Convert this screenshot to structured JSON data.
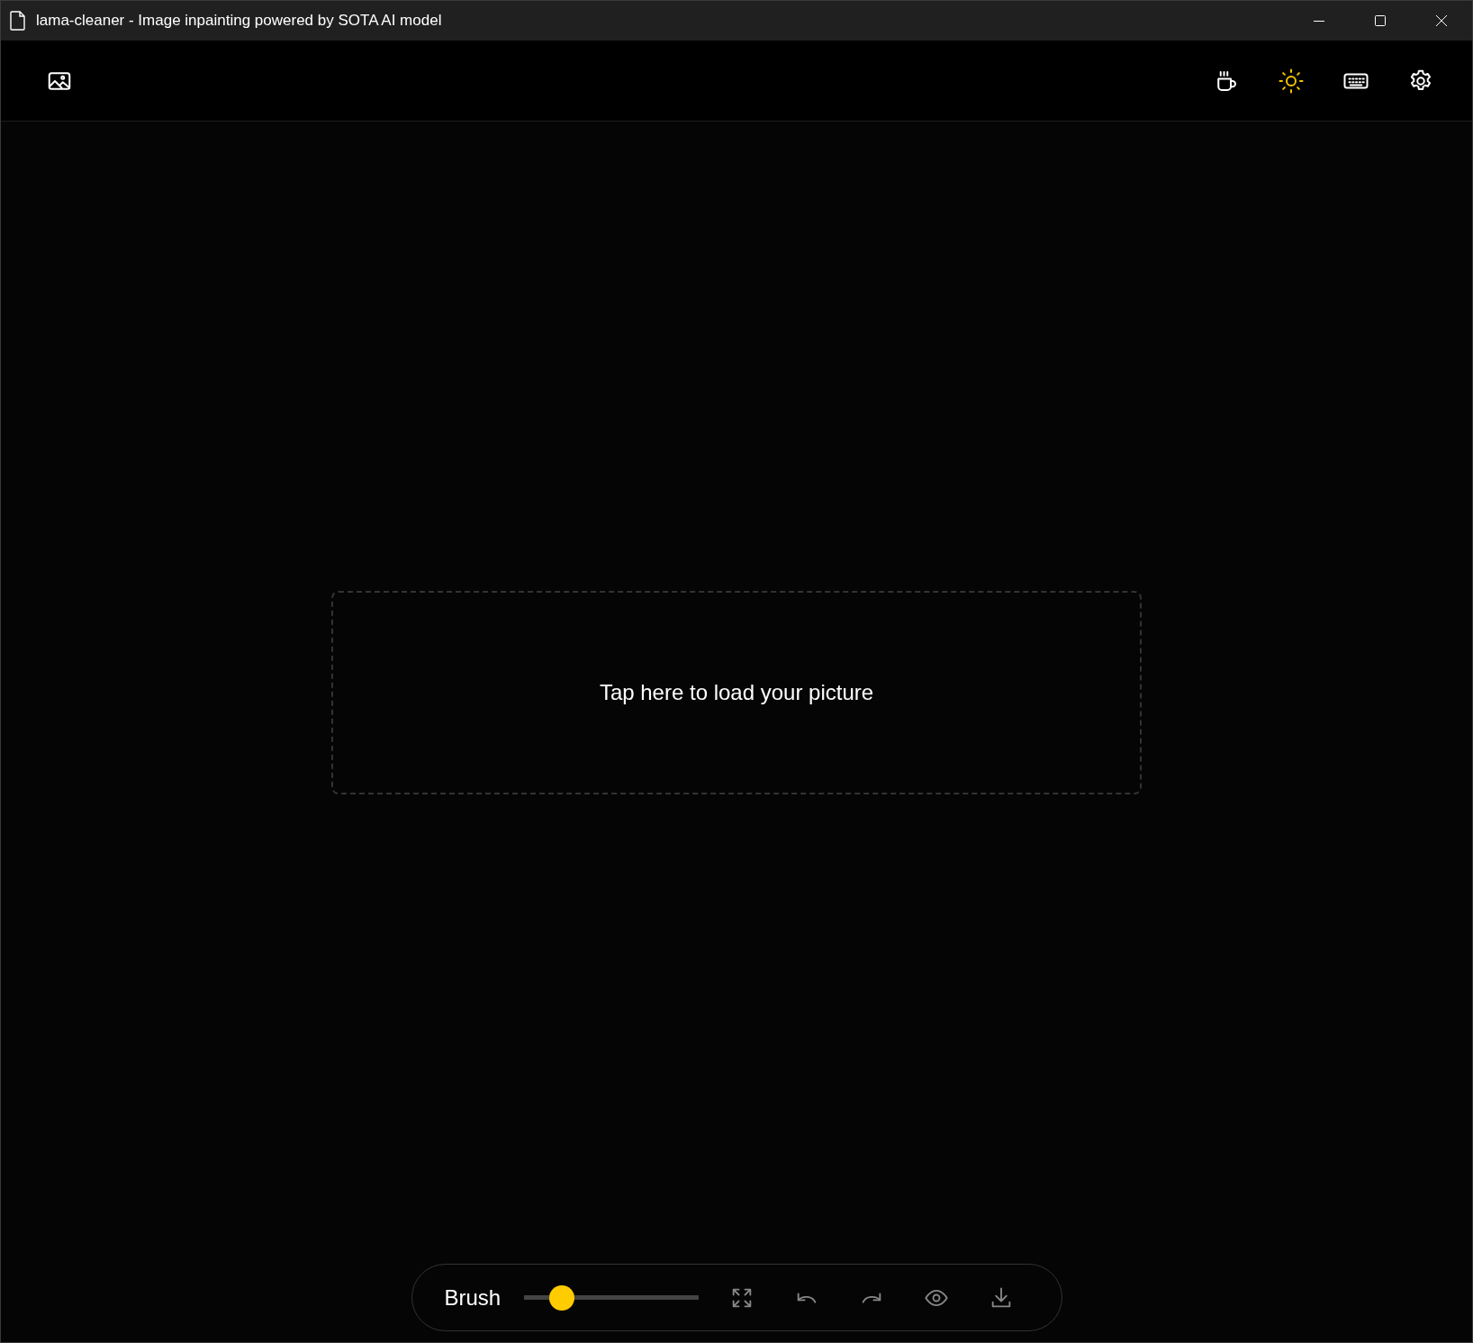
{
  "window": {
    "title": "lama-cleaner - Image inpainting powered by SOTA AI model"
  },
  "header": {
    "left_buttons": [
      {
        "kind": "image"
      }
    ],
    "right_buttons": [
      {
        "kind": "coffee"
      },
      {
        "kind": "sun"
      },
      {
        "kind": "keyboard"
      },
      {
        "kind": "settings"
      }
    ]
  },
  "drop_zone": {
    "text": "Tap here to load your picture"
  },
  "toolbar": {
    "brush": {
      "label": "Brush",
      "level": 0.17
    },
    "tools": [
      {
        "kind": "fullscreen",
        "disabled": true
      },
      {
        "kind": "undo",
        "disabled": true
      },
      {
        "kind": "redo",
        "disabled": true
      },
      {
        "kind": "eye",
        "disabled": true
      },
      {
        "kind": "download",
        "disabled": true
      }
    ]
  }
}
